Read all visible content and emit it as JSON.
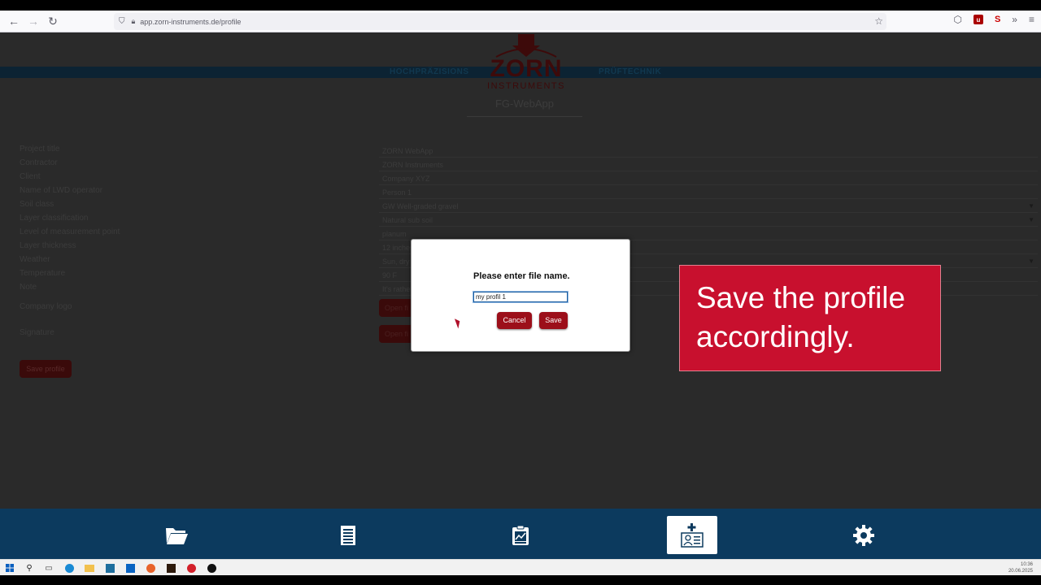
{
  "browser": {
    "url_host": "app.zorn-instruments.de",
    "url_path": "/profile"
  },
  "header": {
    "left_label": "HOCHPRÄZISIONS",
    "right_label": "PRÜFTECHNIK",
    "logo_word": "ZORN",
    "logo_sub": "INSTRUMENTS",
    "app_title": "FG-WebApp"
  },
  "form": {
    "labels": [
      "Project title",
      "Contractor",
      "Client",
      "Name of LWD operator",
      "Soil class",
      "Layer classification",
      "Level of measurement point",
      "Layer thickness",
      "Weather",
      "Temperature",
      "Note"
    ],
    "values": [
      "ZORN WebApp",
      "ZORN Instruments",
      "Company XYZ",
      "Person 1",
      "GW Well-graded gravel",
      "Natural sub soil",
      "planum",
      "12 inches",
      "Sun, dry",
      "90 F",
      "It's rather"
    ],
    "company_logo_label": "Company logo",
    "signature_label": "Signature",
    "open_file_label": "Open fi",
    "save_profile_label": "Save profile"
  },
  "dialog": {
    "title": "Please enter file name.",
    "input_value": "my profil 1",
    "cancel_label": "Cancel",
    "save_label": "Save"
  },
  "callout": {
    "text": "Save the profile accordingly."
  },
  "nav": {
    "items": [
      "folder-icon",
      "document-list-icon",
      "report-chart-icon",
      "add-profile-icon",
      "gear-icon"
    ],
    "active_index": 3
  },
  "clock": {
    "time": "10:36",
    "date": "20.06.2025"
  },
  "colors": {
    "accent_red": "#9c0f1a",
    "callout_red": "#c8102e",
    "nav_blue": "#0c3a5e"
  }
}
